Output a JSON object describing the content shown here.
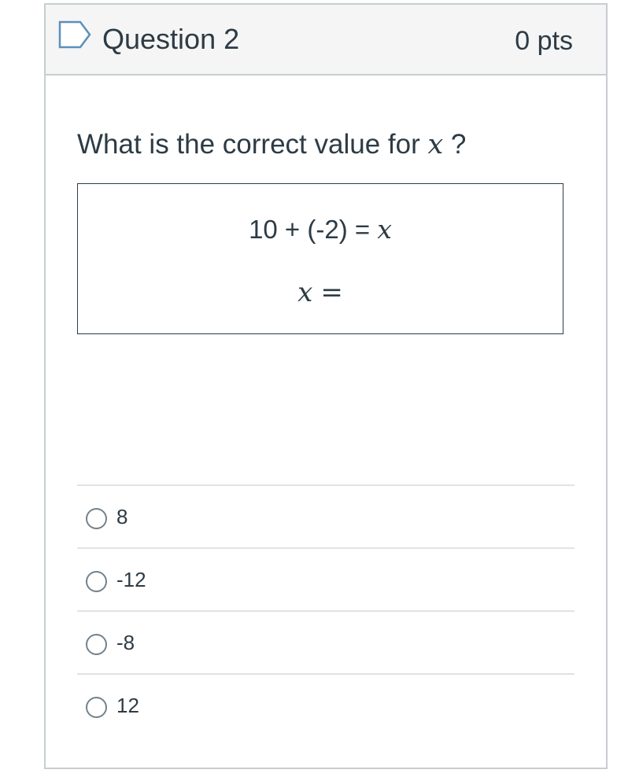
{
  "question": {
    "title": "Question 2",
    "points": "0 pts",
    "flag_icon": "bookmark-flag-icon"
  },
  "prompt": {
    "text_before": "What is the correct value for ",
    "variable": "x",
    "text_after": " ?"
  },
  "equation": {
    "line1_text": "10 + (-2) = ",
    "line1_variable": "x",
    "line2_variable": "x",
    "line2_equals": "="
  },
  "answers": [
    {
      "label": "8",
      "selected": false
    },
    {
      "label": "-12",
      "selected": false
    },
    {
      "label": "-8",
      "selected": false
    },
    {
      "label": "12",
      "selected": false
    }
  ],
  "colors": {
    "text": "#2d3b45",
    "border": "#c7cdd1",
    "header_bg": "#f5f5f5",
    "divider": "#dfe3e5",
    "radio_border": "#73818b",
    "flag_stroke": "#5b8fb9"
  }
}
